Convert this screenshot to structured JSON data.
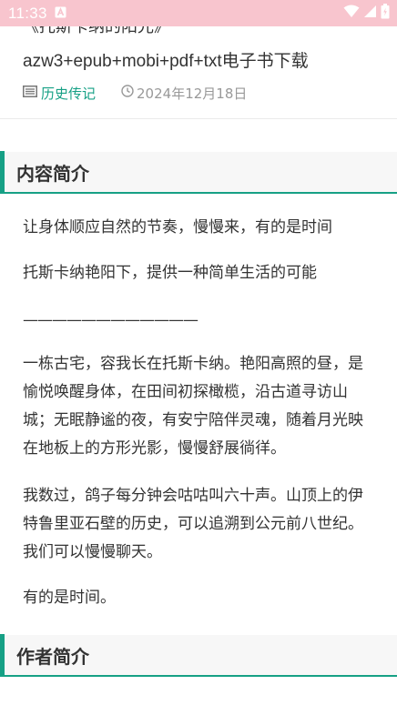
{
  "status_bar": {
    "time": "11:33",
    "icons": [
      "notification-a-icon",
      "wifi-icon",
      "signal-icon",
      "battery-icon"
    ]
  },
  "book": {
    "cut_line": "《托斯卡纳的阳光》",
    "formats_title": "azw3+epub+mobi+pdf+txt电子书下载",
    "category": "历史传记",
    "date": "2024年12月18日"
  },
  "intro_section": {
    "heading": "内容简介",
    "paragraphs": [
      "让身体顺应自然的节奏，慢慢来，有的是时间",
      "托斯卡纳艳阳下，提供一种简单生活的可能",
      "————————————",
      "一栋古宅，容我长在托斯卡纳。艳阳高照的昼，是愉悦唤醒身体，在田间初探橄榄，沿古道寻访山城；无眠静谧的夜，有安宁陪伴灵魂，随着月光映在地板上的方形光影，慢慢舒展徜徉。",
      "我数过，鸽子每分钟会咕咕叫六十声。山顶上的伊特鲁里亚石壁的历史，可以追溯到公元前八世纪。我们可以慢慢聊天。",
      "有的是时间。"
    ]
  },
  "author_section": {
    "heading": "作者简介"
  },
  "colors": {
    "accent": "#16a085",
    "status_bar": "#f8c5ce",
    "text": "#333333",
    "muted": "#999999"
  }
}
